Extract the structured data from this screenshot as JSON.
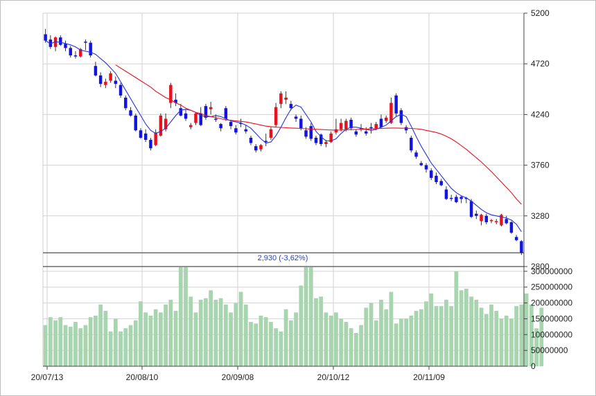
{
  "chart_data": [
    {
      "type": "candlestick",
      "grid": true,
      "colors": {
        "up": "#e8121e",
        "down": "#1414e0",
        "ma_short": "#2233dd",
        "ma_long": "#e8121e"
      },
      "y_ticks": [
        "5200",
        "4720",
        "4240",
        "3760",
        "3280",
        "2800"
      ],
      "ylim": [
        2800,
        5200
      ],
      "x_ticks": [
        "20/07/13",
        "20/08/10",
        "20/09/08",
        "20/10/12",
        "20/11/09"
      ],
      "last_price_label": "2,930 (-3,62%)",
      "last_price": 2930,
      "ohlc": [
        [
          5000,
          5050,
          4920,
          4940
        ],
        [
          4950,
          4990,
          4860,
          4880
        ],
        [
          4880,
          4980,
          4840,
          4970
        ],
        [
          4970,
          4990,
          4890,
          4900
        ],
        [
          4910,
          4940,
          4840,
          4870
        ],
        [
          4870,
          4890,
          4780,
          4800
        ],
        [
          4800,
          4840,
          4770,
          4790
        ],
        [
          4790,
          4870,
          4780,
          4860
        ],
        [
          4930,
          4950,
          4850,
          4920
        ],
        [
          4920,
          4940,
          4780,
          4800
        ],
        [
          4700,
          4740,
          4600,
          4610
        ],
        [
          4610,
          4640,
          4500,
          4530
        ],
        [
          4520,
          4580,
          4490,
          4550
        ],
        [
          4560,
          4650,
          4540,
          4630
        ],
        [
          4560,
          4600,
          4490,
          4530
        ],
        [
          4520,
          4540,
          4400,
          4420
        ],
        [
          4400,
          4420,
          4280,
          4300
        ],
        [
          4280,
          4310,
          4220,
          4230
        ],
        [
          4230,
          4250,
          4080,
          4090
        ],
        [
          4090,
          4110,
          4010,
          4020
        ],
        [
          4060,
          4100,
          3980,
          4000
        ],
        [
          4000,
          4020,
          3900,
          3920
        ],
        [
          3950,
          4100,
          3940,
          4070
        ],
        [
          4040,
          4250,
          4030,
          4230
        ],
        [
          4100,
          4250,
          4080,
          4200
        ],
        [
          4350,
          4540,
          4300,
          4520
        ],
        [
          4380,
          4440,
          4320,
          4350
        ],
        [
          4300,
          4340,
          4220,
          4230
        ],
        [
          4250,
          4290,
          4180,
          4200
        ],
        [
          4120,
          4160,
          4100,
          4140
        ],
        [
          4160,
          4260,
          4140,
          4250
        ],
        [
          4250,
          4310,
          4130,
          4140
        ],
        [
          4320,
          4340,
          4190,
          4210
        ],
        [
          4290,
          4360,
          4240,
          4310
        ],
        [
          4200,
          4240,
          4170,
          4190
        ],
        [
          4150,
          4160,
          4080,
          4110
        ],
        [
          4300,
          4320,
          4180,
          4200
        ],
        [
          4170,
          4190,
          4100,
          4130
        ],
        [
          4110,
          4140,
          4050,
          4070
        ],
        [
          4160,
          4200,
          4120,
          4150
        ],
        [
          4100,
          4140,
          4060,
          4080
        ],
        [
          4020,
          4040,
          3950,
          3970
        ],
        [
          3940,
          3960,
          3880,
          3900
        ],
        [
          3910,
          3960,
          3890,
          3950
        ],
        [
          3990,
          4060,
          3940,
          3980
        ],
        [
          4020,
          4120,
          4000,
          4100
        ],
        [
          4140,
          4350,
          4120,
          4310
        ],
        [
          4340,
          4460,
          4300,
          4440
        ],
        [
          4380,
          4460,
          4340,
          4400
        ],
        [
          4340,
          4370,
          4280,
          4300
        ],
        [
          4220,
          4240,
          4170,
          4200
        ],
        [
          4200,
          4230,
          4090,
          4110
        ],
        [
          4090,
          4120,
          4010,
          4030
        ],
        [
          4130,
          4160,
          3990,
          4010
        ],
        [
          4020,
          4040,
          3950,
          3970
        ],
        [
          4050,
          4060,
          3940,
          3960
        ],
        [
          3960,
          4000,
          3930,
          3980
        ],
        [
          3980,
          4080,
          3970,
          4060
        ],
        [
          4070,
          4200,
          4050,
          4100
        ],
        [
          4100,
          4200,
          4080,
          4160
        ],
        [
          4100,
          4200,
          4080,
          4180
        ],
        [
          4190,
          4210,
          4090,
          4110
        ],
        [
          4080,
          4100,
          4030,
          4050
        ],
        [
          4100,
          4150,
          4080,
          4110
        ],
        [
          4080,
          4120,
          4040,
          4060
        ],
        [
          4120,
          4160,
          4060,
          4110
        ],
        [
          4110,
          4170,
          4090,
          4150
        ],
        [
          4200,
          4240,
          4110,
          4120
        ],
        [
          4180,
          4230,
          4160,
          4210
        ],
        [
          4160,
          4400,
          4150,
          4350
        ],
        [
          4420,
          4440,
          4220,
          4250
        ],
        [
          4280,
          4300,
          4140,
          4160
        ],
        [
          4120,
          4140,
          4060,
          4090
        ],
        [
          4020,
          4040,
          3880,
          3900
        ],
        [
          3880,
          3900,
          3820,
          3840
        ],
        [
          3780,
          3800,
          3750,
          3760
        ],
        [
          3760,
          3780,
          3690,
          3720
        ],
        [
          3710,
          3730,
          3620,
          3640
        ],
        [
          3660,
          3690,
          3580,
          3600
        ],
        [
          3610,
          3630,
          3560,
          3570
        ],
        [
          3530,
          3560,
          3430,
          3440
        ],
        [
          3450,
          3480,
          3420,
          3440
        ],
        [
          3460,
          3480,
          3400,
          3410
        ],
        [
          3460,
          3470,
          3400,
          3440
        ],
        [
          3450,
          3460,
          3400,
          3440
        ],
        [
          3420,
          3440,
          3260,
          3270
        ],
        [
          3300,
          3330,
          3250,
          3280
        ],
        [
          3230,
          3300,
          3190,
          3290
        ],
        [
          3280,
          3300,
          3200,
          3220
        ],
        [
          3230,
          3250,
          3210,
          3240
        ],
        [
          3220,
          3250,
          3200,
          3230
        ],
        [
          3190,
          3300,
          3180,
          3290
        ],
        [
          3250,
          3280,
          3200,
          3210
        ],
        [
          3220,
          3230,
          3110,
          3120
        ],
        [
          3080,
          3100,
          3040,
          3050
        ],
        [
          3040,
          3050,
          2910,
          2930
        ]
      ],
      "ma_short": [
        4940,
        4910,
        4930,
        4923,
        4913,
        4900,
        4880,
        4850,
        4840,
        4830,
        4810,
        4770,
        4730,
        4680,
        4630,
        4550,
        4470,
        4390,
        4310,
        4230,
        4150,
        4090,
        4060,
        4080,
        4110,
        4170,
        4230,
        4280,
        4290,
        4280,
        4260,
        4230,
        4220,
        4220,
        4230,
        4220,
        4200,
        4180,
        4170,
        4160,
        4140,
        4110,
        4060,
        4010,
        3970,
        3980,
        4040,
        4120,
        4210,
        4290,
        4330,
        4310,
        4240,
        4170,
        4080,
        4030,
        3990,
        3990,
        4010,
        4060,
        4100,
        4120,
        4120,
        4110,
        4100,
        4090,
        4100,
        4120,
        4140,
        4180,
        4220,
        4240,
        4220,
        4130,
        4030,
        3940,
        3860,
        3780,
        3720,
        3660,
        3600,
        3540,
        3500,
        3470,
        3450,
        3420,
        3380,
        3340,
        3310,
        3290,
        3280,
        3270,
        3260,
        3240,
        3200,
        3130
      ],
      "ma_long_start_index": 14,
      "ma_long": [
        4710,
        4680,
        4650,
        4620,
        4590,
        4560,
        4530,
        4500,
        4460,
        4430,
        4400,
        4380,
        4350,
        4330,
        4300,
        4280,
        4260,
        4250,
        4230,
        4220,
        4210,
        4200,
        4190,
        4185,
        4180,
        4175,
        4170,
        4160,
        4150,
        4140,
        4130,
        4125,
        4120,
        4118,
        4115,
        4112,
        4110,
        4108,
        4105,
        4102,
        4100,
        4098,
        4095,
        4093,
        4092,
        4093,
        4095,
        4097,
        4098,
        4100,
        4102,
        4104,
        4106,
        4108,
        4110,
        4112,
        4112,
        4110,
        4110,
        4108,
        4105,
        4100,
        4090,
        4080,
        4070,
        4055,
        4035,
        4010,
        3980,
        3945,
        3910,
        3870,
        3830,
        3790,
        3745,
        3700,
        3650,
        3600,
        3550,
        3500,
        3440,
        3390
      ]
    },
    {
      "type": "bar",
      "color": "#a8d5b0",
      "y_ticks": [
        "300000000",
        "250000000",
        "200000000",
        "150000000",
        "100000000",
        "50000000",
        "0"
      ],
      "ylim": [
        0,
        315000000
      ],
      "values": [
        130000000,
        155000000,
        145000000,
        155000000,
        130000000,
        125000000,
        140000000,
        120000000,
        130000000,
        155000000,
        160000000,
        195000000,
        175000000,
        110000000,
        150000000,
        110000000,
        120000000,
        130000000,
        145000000,
        205000000,
        170000000,
        160000000,
        180000000,
        170000000,
        195000000,
        210000000,
        175000000,
        335000000,
        330000000,
        220000000,
        170000000,
        210000000,
        215000000,
        240000000,
        210000000,
        215000000,
        195000000,
        170000000,
        200000000,
        235000000,
        195000000,
        140000000,
        135000000,
        160000000,
        155000000,
        140000000,
        120000000,
        110000000,
        180000000,
        145000000,
        170000000,
        255000000,
        345000000,
        340000000,
        215000000,
        220000000,
        170000000,
        160000000,
        170000000,
        150000000,
        140000000,
        120000000,
        105000000,
        130000000,
        185000000,
        200000000,
        145000000,
        210000000,
        180000000,
        235000000,
        135000000,
        150000000,
        150000000,
        160000000,
        175000000,
        180000000,
        205000000,
        230000000,
        190000000,
        190000000,
        210000000,
        190000000,
        300000000,
        240000000,
        245000000,
        220000000,
        210000000,
        185000000,
        165000000,
        195000000,
        175000000,
        150000000,
        160000000,
        150000000,
        190000000,
        195000000,
        230000000,
        195000000,
        120000000,
        185000000
      ]
    }
  ]
}
